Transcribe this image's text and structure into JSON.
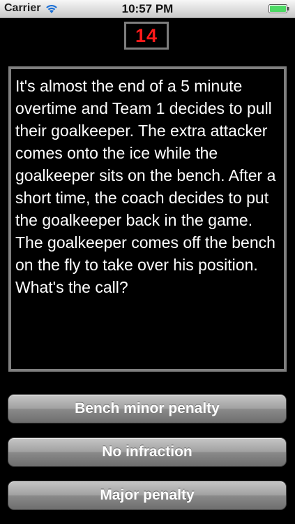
{
  "status_bar": {
    "carrier": "Carrier",
    "time": "10:57 PM",
    "wifi_icon": "wifi-icon",
    "battery_icon": "battery-icon",
    "battery_color": "#4cd964"
  },
  "timer": {
    "value": "14",
    "color": "#ff1a1a"
  },
  "question": {
    "text": "It's almost the end of a 5 minute overtime and Team 1 decides to pull their goalkeeper. The extra attacker comes onto the ice while the goalkeeper sits on the bench.  After a short time, the coach decides to put the goalkeeper back in the game.  The goalkeeper comes off the bench on the fly to take over his position.  What's the call?"
  },
  "answers": [
    {
      "label": "Bench minor penalty"
    },
    {
      "label": "No infraction"
    },
    {
      "label": "Major penalty"
    }
  ]
}
